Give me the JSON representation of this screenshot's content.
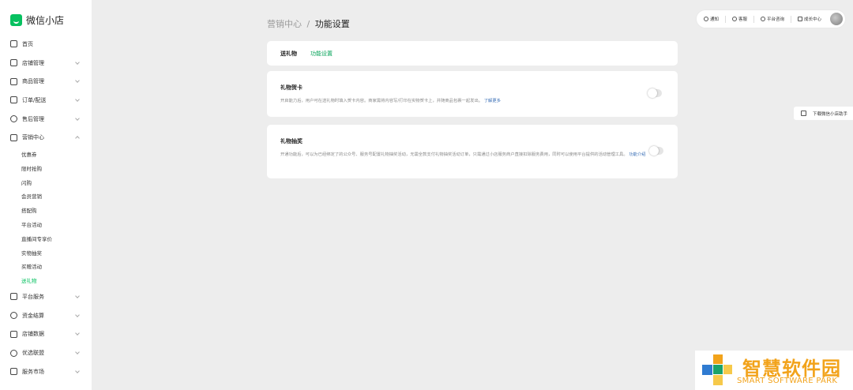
{
  "app": {
    "title": "微信小店"
  },
  "sidebar": {
    "items": [
      {
        "label": "首页",
        "icon": "home-icon",
        "chevron": false
      },
      {
        "label": "店铺管理",
        "icon": "store-icon",
        "chevron": true
      },
      {
        "label": "商品管理",
        "icon": "bag-icon",
        "chevron": true
      },
      {
        "label": "订单/配送",
        "icon": "order-icon",
        "chevron": true
      },
      {
        "label": "售后管理",
        "icon": "headset-icon",
        "chevron": true
      },
      {
        "label": "营销中心",
        "icon": "marketing-icon",
        "chevron": true,
        "expanded": true
      }
    ],
    "sub_items": [
      "优惠券",
      "限时抢购",
      "闪购",
      "会员营销",
      "搭配购",
      "平台活动",
      "直播间专享价",
      "实物抽奖",
      "买赠活动",
      "送礼物"
    ],
    "active_sub": "送礼物",
    "items_after": [
      {
        "label": "平台服务",
        "icon": "service-icon"
      },
      {
        "label": "资金结算",
        "icon": "money-icon"
      },
      {
        "label": "店铺数据",
        "icon": "chart-icon"
      },
      {
        "label": "优选联盟",
        "icon": "network-icon"
      },
      {
        "label": "服务市场",
        "icon": "grid-icon"
      }
    ]
  },
  "breadcrumb": {
    "parent": "营销中心",
    "separator": "/",
    "current": "功能设置"
  },
  "topbar": {
    "notify": "通知",
    "service": "客服",
    "consult": "平台咨询",
    "growth": "成长中心"
  },
  "helper": {
    "label": "下载微信小店助手"
  },
  "tabs": [
    {
      "label": "送礼物",
      "active": true
    },
    {
      "label": "功能设置",
      "active": false
    }
  ],
  "features": [
    {
      "title": "礼物贺卡",
      "desc": "开启能力后，用户可在送礼物时填入贺卡内容。商家需将内容写/打印在实物贺卡上，并随商品包裹一起发出。",
      "link": "了解更多",
      "enabled": false
    },
    {
      "title": "礼物抽奖",
      "desc": "开通功能后，可以为已经绑定了的公众号、服务号配置礼物抽奖活动，无需全款支付礼物抽奖活动订单，只需通过小店服务商户直接扣除服务费用，同时可以使用平台提供的活动管理工具。",
      "link": "功能介绍",
      "enabled": false
    }
  ],
  "watermark": {
    "title": "智慧软件园",
    "subtitle": "SMART SOFTWARE PARK"
  },
  "colors": {
    "accent": "#07c160",
    "link": "#3a6fb6",
    "watermark": "#f2a31b"
  }
}
